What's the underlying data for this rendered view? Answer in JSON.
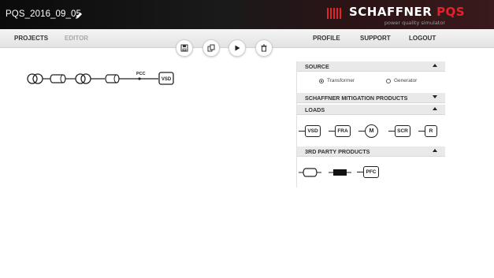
{
  "header": {
    "project_title": "PQS_2016_09_05",
    "logo_brand": "SCHAFFNER",
    "logo_product": "PQS",
    "logo_tagline": "power quality simulator"
  },
  "nav": {
    "projects": "PROJECTS",
    "editor": "EDITOR",
    "profile": "PROFILE",
    "support": "SUPPORT",
    "logout": "LOGOUT"
  },
  "toolbar": {
    "buttons": [
      "save-icon",
      "copy-icon",
      "play-icon",
      "delete-icon"
    ]
  },
  "diagram": {
    "pcc_label": "PCC",
    "load_label": "VSD"
  },
  "panel": {
    "source": {
      "title": "SOURCE",
      "options": [
        {
          "label": "Transformer",
          "selected": true
        },
        {
          "label": "Generator",
          "selected": false
        }
      ]
    },
    "mitigation": {
      "title": "SCHAFFNER MITIGATION PRODUCTS"
    },
    "loads": {
      "title": "LOADS",
      "items": [
        "VSD",
        "FRA",
        "M",
        "SCR",
        "R"
      ]
    },
    "third_party": {
      "title": "3RD PARTY PRODUCTS",
      "items": [
        "PFC"
      ]
    }
  },
  "colors": {
    "header_bg": "#111111",
    "brand_red": "#e4222b",
    "nav_bg": "#ececec",
    "section_bg": "#e9e9e9"
  }
}
